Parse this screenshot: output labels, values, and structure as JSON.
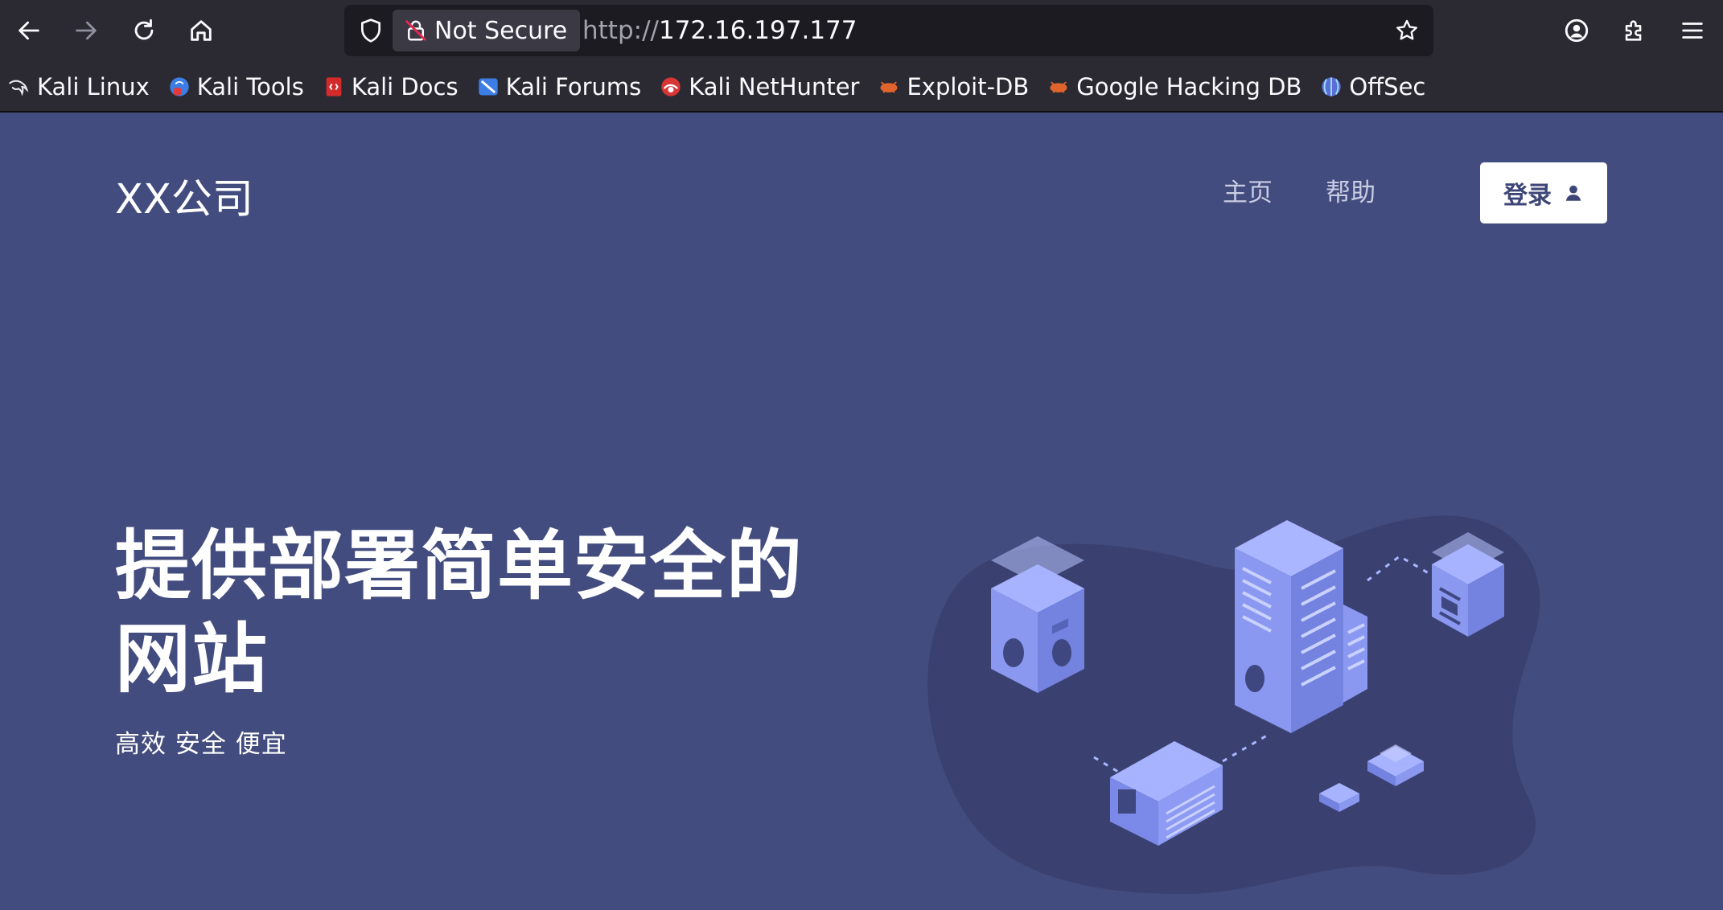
{
  "browser": {
    "security_label": "Not Secure",
    "url_protocol": "http://",
    "url_host": "172.16.197.177",
    "bookmarks": [
      {
        "label": "Kali Linux",
        "icon": "kali-dragon-icon"
      },
      {
        "label": "Kali Tools",
        "icon": "kali-tools-icon"
      },
      {
        "label": "Kali Docs",
        "icon": "kali-docs-icon"
      },
      {
        "label": "Kali Forums",
        "icon": "kali-forums-icon"
      },
      {
        "label": "Kali NetHunter",
        "icon": "kali-nethunter-icon"
      },
      {
        "label": "Exploit-DB",
        "icon": "exploit-db-icon"
      },
      {
        "label": "Google Hacking DB",
        "icon": "ghdb-icon"
      },
      {
        "label": "OffSec",
        "icon": "offsec-icon"
      }
    ]
  },
  "site": {
    "brand": "XX公司",
    "nav": {
      "home": "主页",
      "help": "帮助"
    },
    "login_label": "登录",
    "hero": {
      "title_line1": "提供部署简单安全的",
      "title_line2": "网站",
      "subtitle": "高效 安全 便宜"
    }
  },
  "colors": {
    "page_bg": "#434c7e",
    "chrome_bg": "#2b2a33",
    "urlbar_bg": "#1c1b22",
    "illustration_blob": "#3a4170",
    "illustration_building": "#8c9cf4"
  }
}
